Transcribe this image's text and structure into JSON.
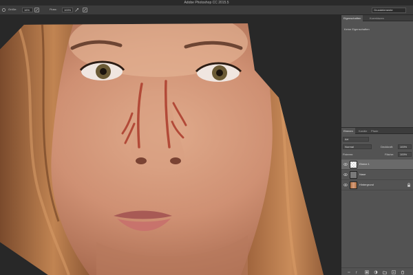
{
  "window": {
    "title": "Adobe Photoshop CC 2015.5"
  },
  "options_bar": {
    "size_label": "Größe:",
    "size_value": "16%",
    "flow_label": "Fluss:",
    "flow_value": "100%",
    "workspace": "Grundelemente"
  },
  "properties_panel": {
    "tabs": [
      "Eigenschaften",
      "Korrekturen"
    ],
    "body_text": "Keine Eigenschaften"
  },
  "layers_panel": {
    "tabs": [
      "Ebenen",
      "Kanäle",
      "Pfade"
    ],
    "filter_kind": "Art",
    "blend_mode": "Normal",
    "opacity_label": "Deckkraft:",
    "opacity_value": "100%",
    "lock_label": "Fixieren:",
    "fill_label": "Fläche:",
    "fill_value": "100%",
    "layers": [
      {
        "name": "Ebene 1",
        "thumb": "transparent",
        "active": true
      },
      {
        "name": "Nase",
        "thumb": "gray",
        "active": false
      },
      {
        "name": "Hintergrund",
        "thumb": "photo",
        "active": false
      }
    ]
  },
  "colors": {
    "stroke": "#b24a38",
    "panel": "#535353",
    "canvas_bg": "#282828"
  }
}
